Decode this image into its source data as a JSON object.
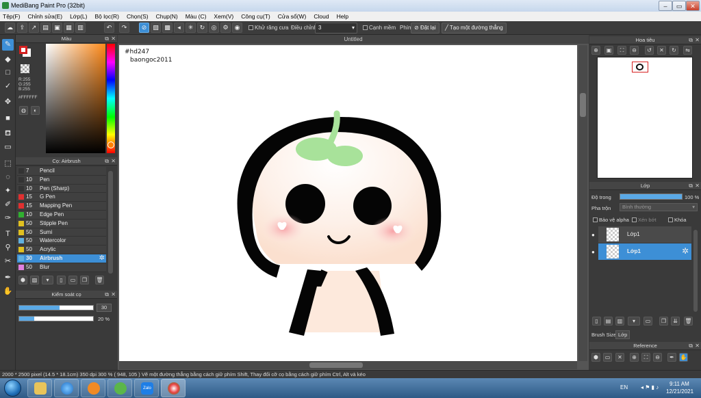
{
  "window": {
    "title": "MediBang Paint Pro (32bit)"
  },
  "menu": [
    "Tệp(F)",
    "Chỉnh sửa(E)",
    "Lớp(L)",
    "Bộ lọc(R)",
    "Chọn(S)",
    "Chụp(N)",
    "Màu (C)",
    "Xem(V)",
    "Công cụ(T)",
    "Cửa sổ(W)",
    "Cloud",
    "Help"
  ],
  "toolbar": {
    "antialias_label": "Khử răng cưa",
    "adjust_label": "Điều chỉnh",
    "adjust_value": "3",
    "edge_label": "Cạnh mềm",
    "key_label": "Phím",
    "reset_label": "Đặt lại",
    "straight_line_label": "Tạo một đường thẳng"
  },
  "color_panel": {
    "title": "Màu",
    "r": "R:255",
    "g": "G:255",
    "b": "B:255",
    "hex": "#FFFFFF",
    "primary_color": "#d42020",
    "secondary_color": "#ffffff"
  },
  "brush_panel": {
    "title": "Cọ: Airbrush",
    "items": [
      {
        "size": "7",
        "name": "Pencil",
        "color": "#333333"
      },
      {
        "size": "10",
        "name": "Pen",
        "color": "#333333"
      },
      {
        "size": "10",
        "name": "Pen (Sharp)",
        "color": "#333333"
      },
      {
        "size": "15",
        "name": "G Pen",
        "color": "#e03030"
      },
      {
        "size": "15",
        "name": "Mapping Pen",
        "color": "#e03030"
      },
      {
        "size": "10",
        "name": "Edge Pen",
        "color": "#30b030"
      },
      {
        "size": "50",
        "name": "Stipple Pen",
        "color": "#e0c020"
      },
      {
        "size": "50",
        "name": "Sumi",
        "color": "#e0c020"
      },
      {
        "size": "50",
        "name": "Watercolor",
        "color": "#60b0e0"
      },
      {
        "size": "50",
        "name": "Acrylic",
        "color": "#e0c020"
      },
      {
        "size": "30",
        "name": "Airbrush",
        "color": "#60b0e0"
      },
      {
        "size": "50",
        "name": "Blur",
        "color": "#e080e0"
      }
    ]
  },
  "brush_control": {
    "title": "Kiểm soát cọ",
    "size_value": "30",
    "size_fill": 0.55,
    "opacity_value": "20 %",
    "opacity_fill": 0.2
  },
  "canvas": {
    "tab_title": "Untitled",
    "text_line1": "#hd247",
    "text_line2": "baongoc2011"
  },
  "navigator": {
    "title": "Hoa tiêu"
  },
  "layer_panel": {
    "title": "Lớp",
    "opacity_label": "Độ trong",
    "opacity_value": "100 %",
    "opacity_fill": 1.0,
    "blend_label": "Pha trộn",
    "blend_value": "Bình thường",
    "protect_alpha": "Bảo vệ alpha",
    "clipping": "Xén bớt",
    "lock": "Khóa",
    "layers": [
      {
        "name": "Lớp1",
        "selected": false
      },
      {
        "name": "Lớp1",
        "selected": true
      }
    ],
    "tab_brush_size": "Brush Size",
    "tab_layer": "Lớp"
  },
  "reference_panel": {
    "title": "Reference"
  },
  "status": {
    "text": "2000 * 2500 pixel   (14.5 * 18.1cm)   350 dpi   300 %   ( 948, 105 )   Vẽ một đường thẳng bằng cách giữ phím Shift, Thay đổi cỡ cọ bằng cách giữ phím Ctrl, Alt và kéo"
  },
  "taskbar": {
    "language": "EN",
    "time": "9:11 AM",
    "date": "12/21/2021",
    "zalo_label": "Zalo"
  }
}
